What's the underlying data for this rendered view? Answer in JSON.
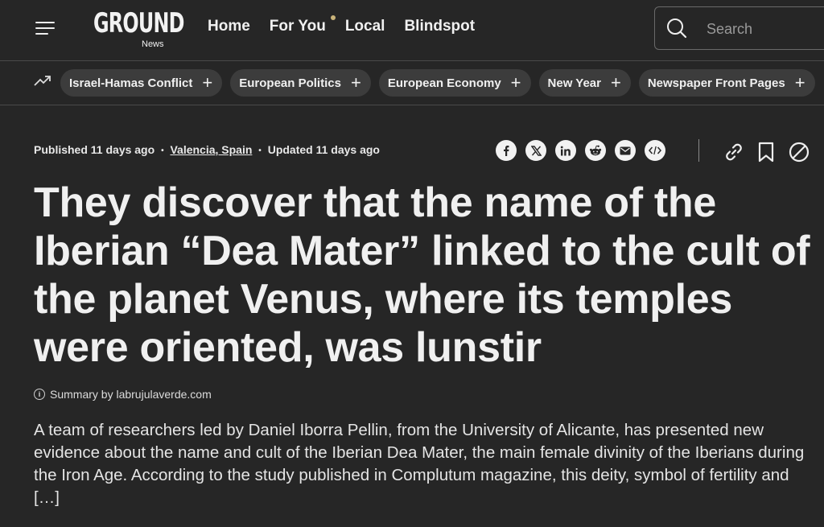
{
  "header": {
    "logo_text": "GROUND",
    "logo_sub": "News",
    "nav": [
      "Home",
      "For You",
      "Local",
      "Blindspot"
    ],
    "search_placeholder": "Search"
  },
  "topics": [
    "Israel-Hamas Conflict",
    "European Politics",
    "European Economy",
    "New Year",
    "Newspaper Front Pages"
  ],
  "topic_plus": "+",
  "article": {
    "published": "Published 11 days ago",
    "location": "Valencia, Spain",
    "updated": "Updated 11 days ago",
    "separator": "•",
    "share_icons": [
      "facebook-icon",
      "x-icon",
      "linkedin-icon",
      "reddit-icon",
      "email-icon",
      "embed-icon"
    ],
    "actions": [
      "link-icon",
      "bookmark-icon",
      "block-icon"
    ],
    "headline": "They discover that the name of the Iberian “Dea Mater” linked to the cult of the planet Venus, where its temples were oriented, was lunstir",
    "summary_by": "Summary by labrujulaverde.com",
    "body": "A team of researchers led by Daniel Iborra Pellin, from the University of Alicante, has presented new evidence about the name and cult of the Iberian Dea Mater, the main female divinity of the Iberians during the Iron Age. According to the study published in Complutum magazine, this deity, symbol of fertility and […]"
  },
  "colors": {
    "background": "#262626",
    "pill": "#3c3c3c",
    "accent_dot": "#c9b37a",
    "text": "#f0f0f0"
  }
}
